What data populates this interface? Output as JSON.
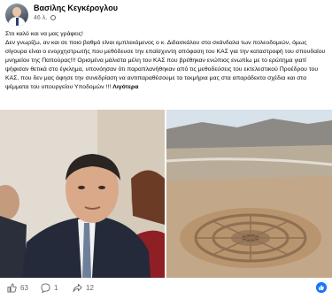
{
  "post": {
    "author": "Βασίλης Κεγκέρογλου",
    "time": "46 λ.",
    "paragraph1": "Στο καλό και να μας γράφεις!",
    "paragraph2": "Δεν γνωρίζω, αν και σε ποιο βαθμό είναι εμπλεκόμενος ο κ. Διδασκάλου στα σκάνδαλα των πολεοδομιών, όμως σίγουρα είναι ο ενορχηστρωτής που μεθόδευσε την επαίσχυντη απόφαση του ΚΑΣ για την καταστροφή του σπουδαίου μνημείου της Παπούρας!!! Ορισμένα μάλιστα μέλη του ΚΑΣ που βρέθηκαν ενώπιος ενωπίω με το ερώτημα γιατί ψήφισαν θετικά στο έγκλημα, υπονόησαν ότι παραπλανήθηκαν από τις μεθοδεύσεις του εκτελεστικού Προέδρου του ΚΑΣ, που δεν μας άφησε την συνεδρίαση να αντιπαραθέσουμε τα τεκμήρια μας στα απαράδεκτα σχέδια και στα ψέμματα του υπουργείου Υποδομών !!!",
    "see_more": "Λιγότερα"
  },
  "counts": {
    "likes": "63",
    "comments": "1",
    "shares": "12"
  },
  "colors": {
    "accent": "#1877f2",
    "secondary_text": "#65676b"
  }
}
